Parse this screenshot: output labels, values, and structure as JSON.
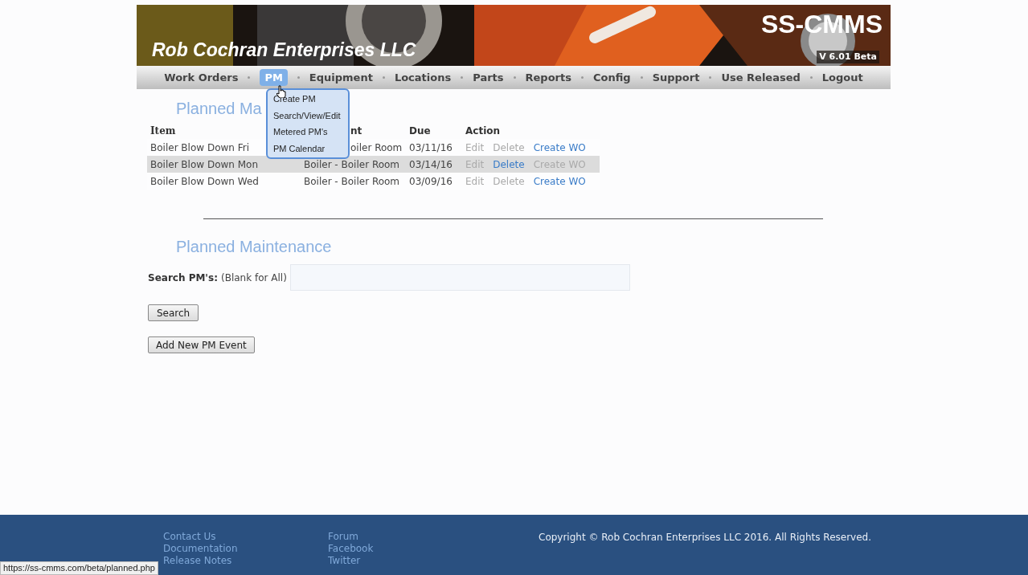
{
  "banner": {
    "company": "Rob Cochran Enterprises LLC",
    "product": "SS-CMMS",
    "version": "V 6.01 Beta"
  },
  "nav": [
    {
      "label": "Work Orders",
      "selected": false
    },
    {
      "label": "PM",
      "selected": true
    },
    {
      "label": "Equipment",
      "selected": false
    },
    {
      "label": "Locations",
      "selected": false
    },
    {
      "label": "Parts",
      "selected": false
    },
    {
      "label": "Reports",
      "selected": false
    },
    {
      "label": "Config",
      "selected": false
    },
    {
      "label": "Support",
      "selected": false
    },
    {
      "label": "Use Released",
      "selected": false
    },
    {
      "label": "Logout",
      "selected": false
    }
  ],
  "dropdown": [
    "Create PM",
    "Search/View/Edit",
    "Metered PM's",
    "PM Calendar"
  ],
  "heading_top": "Planned Ma",
  "table": {
    "columns": [
      "Item",
      "nt",
      "Due",
      "Action"
    ],
    "rows": [
      {
        "selected": false,
        "item": "Boiler Blow Down Fri",
        "equipment": "oiler Room",
        "due": "03/11/16",
        "actions": [
          {
            "label": "Edit",
            "disabled": true
          },
          {
            "label": "Delete",
            "disabled": true
          },
          {
            "label": "Create WO",
            "disabled": false
          }
        ]
      },
      {
        "selected": true,
        "item": "Boiler Blow Down Mon",
        "equipment": "Boiler - Boiler Room",
        "due": "03/14/16",
        "actions": [
          {
            "label": "Edit",
            "disabled": true
          },
          {
            "label": "Delete",
            "disabled": false
          },
          {
            "label": "Create WO",
            "disabled": true
          }
        ]
      },
      {
        "selected": false,
        "item": "Boiler Blow Down Wed",
        "equipment": "Boiler - Boiler Room",
        "due": "03/09/16",
        "actions": [
          {
            "label": "Edit",
            "disabled": true
          },
          {
            "label": "Delete",
            "disabled": true
          },
          {
            "label": "Create WO",
            "disabled": false
          }
        ]
      }
    ]
  },
  "heading": "Planned Maintenance",
  "search": {
    "label": "Search PM's:",
    "hint": "(Blank for All)"
  },
  "buttons": [
    "Search",
    "Add New PM Event"
  ],
  "footer": {
    "links_1": [
      "Contact Us",
      "Documentation",
      "Release Notes"
    ],
    "links_2": [
      "Forum",
      "Facebook",
      "Twitter"
    ],
    "copyright": "Copyright © Rob Cochran Enterprises LLC 2016. All Rights Reserved."
  },
  "status_url": "https://ss-cmms.com/beta/planned.php"
}
